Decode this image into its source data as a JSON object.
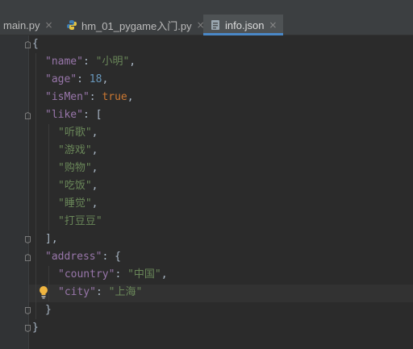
{
  "tabs": [
    {
      "label": "main.py",
      "close": "×",
      "icon": "python-file-icon",
      "active": false
    },
    {
      "label": "hm_01_pygame入门.py",
      "close": "×",
      "icon": "python-file-icon",
      "active": false
    },
    {
      "label": "info.json",
      "close": "×",
      "icon": "json-file-icon",
      "active": true
    }
  ],
  "code": {
    "l1": {
      "p1": "{"
    },
    "l2": {
      "k": "\"name\"",
      "p1": ": ",
      "v": "\"小明\"",
      "p2": ","
    },
    "l3": {
      "k": "\"age\"",
      "p1": ": ",
      "v": "18",
      "p2": ","
    },
    "l4": {
      "k": "\"isMen\"",
      "p1": ": ",
      "v": "true",
      "p2": ","
    },
    "l5": {
      "k": "\"like\"",
      "p1": ": ["
    },
    "l6": {
      "v": "\"听歌\"",
      "p2": ","
    },
    "l7": {
      "v": "\"游戏\"",
      "p2": ","
    },
    "l8": {
      "v": "\"购物\"",
      "p2": ","
    },
    "l9": {
      "v": "\"吃饭\"",
      "p2": ","
    },
    "l10": {
      "v": "\"睡觉\"",
      "p2": ","
    },
    "l11": {
      "v": "\"打豆豆\""
    },
    "l12": {
      "p1": "],"
    },
    "l13": {
      "k": "\"address\"",
      "p1": ": {"
    },
    "l14": {
      "k": "\"country\"",
      "p1": ": ",
      "v": "\"中国\"",
      "p2": ","
    },
    "l15": {
      "k": "\"city\"",
      "p1": ": ",
      "v": "\"上海\""
    },
    "l16": {
      "p1": "}"
    },
    "l17": {
      "p1": "}"
    }
  },
  "colors": {
    "key": "#9876aa",
    "string": "#6a8759",
    "number": "#6897bb",
    "boolean": "#cc7832",
    "accent": "#4a88c7"
  },
  "icons": [
    "python-file-icon",
    "json-file-icon",
    "fold-marker-icon",
    "lightbulb-icon",
    "close-icon"
  ]
}
